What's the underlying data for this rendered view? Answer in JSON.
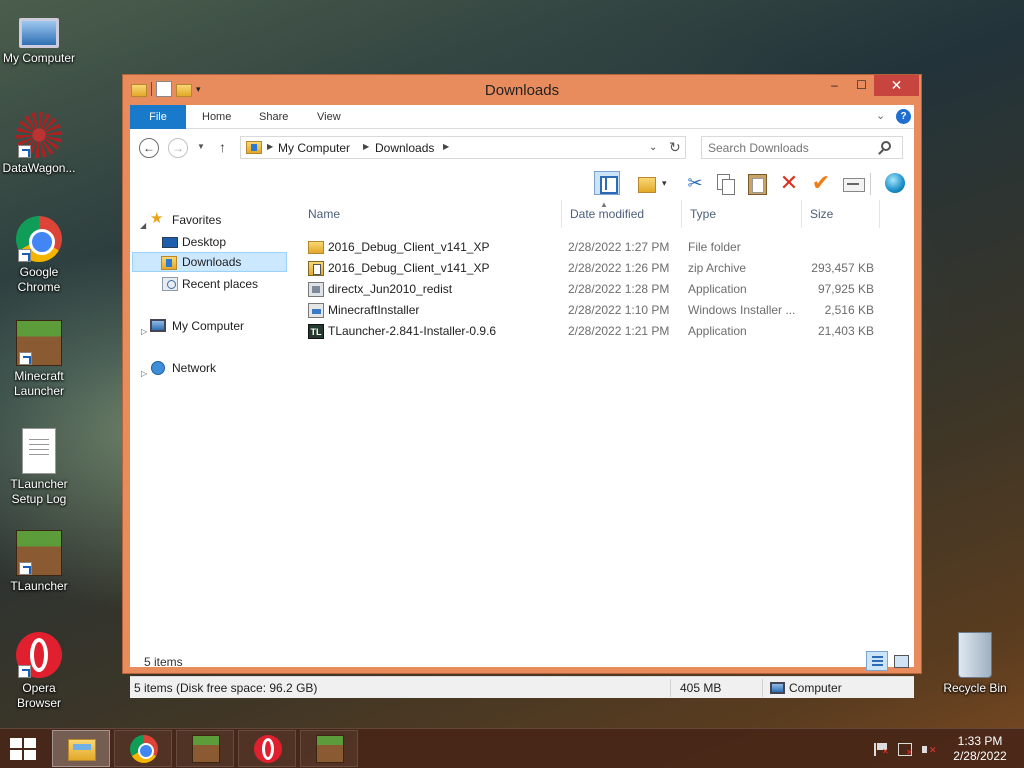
{
  "desktop": {
    "icons": [
      {
        "label": "My Computer",
        "icon": "computer-icon"
      },
      {
        "label": "DataWagon...",
        "icon": "datawagon-icon"
      },
      {
        "label": "Google Chrome",
        "icon": "chrome-icon"
      },
      {
        "label": "Minecraft Launcher",
        "icon": "minecraft-icon"
      },
      {
        "label": "TLauncher Setup Log",
        "icon": "text-document-icon"
      },
      {
        "label": "TLauncher",
        "icon": "minecraft-icon"
      },
      {
        "label": "Opera Browser",
        "icon": "opera-icon"
      }
    ],
    "recycle_bin": "Recycle Bin"
  },
  "window": {
    "title": "Downloads",
    "controls": {
      "minimize": "–",
      "maximize": "☐",
      "close": "✕"
    },
    "ribbon_tabs": [
      "File",
      "Home",
      "Share",
      "View"
    ],
    "help": "?",
    "address": {
      "crumbs": [
        "My Computer",
        "Downloads"
      ]
    },
    "search": {
      "placeholder": "Search Downloads"
    },
    "nav_pane": {
      "favorites": "Favorites",
      "desktop": "Desktop",
      "downloads": "Downloads",
      "recent": "Recent places",
      "computer": "My Computer",
      "network": "Network"
    },
    "columns": {
      "name": "Name",
      "date": "Date modified",
      "type": "Type",
      "size": "Size"
    },
    "files": [
      {
        "name": "2016_Debug_Client_v141_XP",
        "date": "2/28/2022 1:27 PM",
        "type": "File folder",
        "size": "",
        "icon": "folder-icon"
      },
      {
        "name": "2016_Debug_Client_v141_XP",
        "date": "2/28/2022 1:26 PM",
        "type": "zip Archive",
        "size": "293,457 KB",
        "icon": "zip-icon"
      },
      {
        "name": "directx_Jun2010_redist",
        "date": "2/28/2022 1:28 PM",
        "type": "Application",
        "size": "97,925 KB",
        "icon": "application-icon"
      },
      {
        "name": "MinecraftInstaller",
        "date": "2/28/2022 1:10 PM",
        "type": "Windows Installer ...",
        "size": "2,516 KB",
        "icon": "installer-icon"
      },
      {
        "name": "TLauncher-2.841-Installer-0.9.6",
        "date": "2/28/2022 1:21 PM",
        "type": "Application",
        "size": "21,403 KB",
        "icon": "tlauncher-icon"
      }
    ],
    "items_count": "5 items",
    "status": {
      "left": "5 items (Disk free space: 96.2 GB)",
      "size": "405 MB",
      "location": "Computer"
    }
  },
  "taskbar": {
    "apps": [
      "File Explorer",
      "Google Chrome",
      "Minecraft Launcher",
      "Opera",
      "TLauncher"
    ],
    "clock_time": "1:33 PM",
    "clock_date": "2/28/2022"
  }
}
